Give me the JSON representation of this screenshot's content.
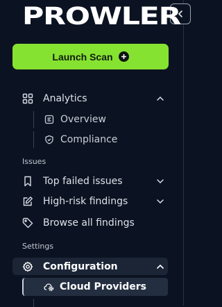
{
  "brand": {
    "logo_text": "PROWLER"
  },
  "launch": {
    "label": "Launch Scan",
    "icon": "plus-circle-icon",
    "color": "#86e230"
  },
  "nav": {
    "analytics": {
      "label": "Analytics",
      "icon": "grid-icon"
    },
    "overview": {
      "label": "Overview",
      "icon": "overview-icon"
    },
    "compliance": {
      "label": "Compliance",
      "icon": "shield-icon"
    },
    "issues_section": "Issues",
    "top_failed": {
      "label": "Top failed issues",
      "icon": "bookmark-icon"
    },
    "high_risk": {
      "label": "High-risk findings",
      "icon": "edit-icon"
    },
    "browse_all": {
      "label": "Browse all findings",
      "icon": "tag-icon"
    },
    "settings_section": "Settings",
    "configuration": {
      "label": "Configuration",
      "icon": "gear-icon"
    },
    "cloud_providers": {
      "label": "Cloud Providers",
      "icon": "cloud-gear-icon"
    }
  },
  "colors": {
    "background": "#0b1322",
    "accent": "#86e230",
    "active_bg": "#1b2536"
  }
}
